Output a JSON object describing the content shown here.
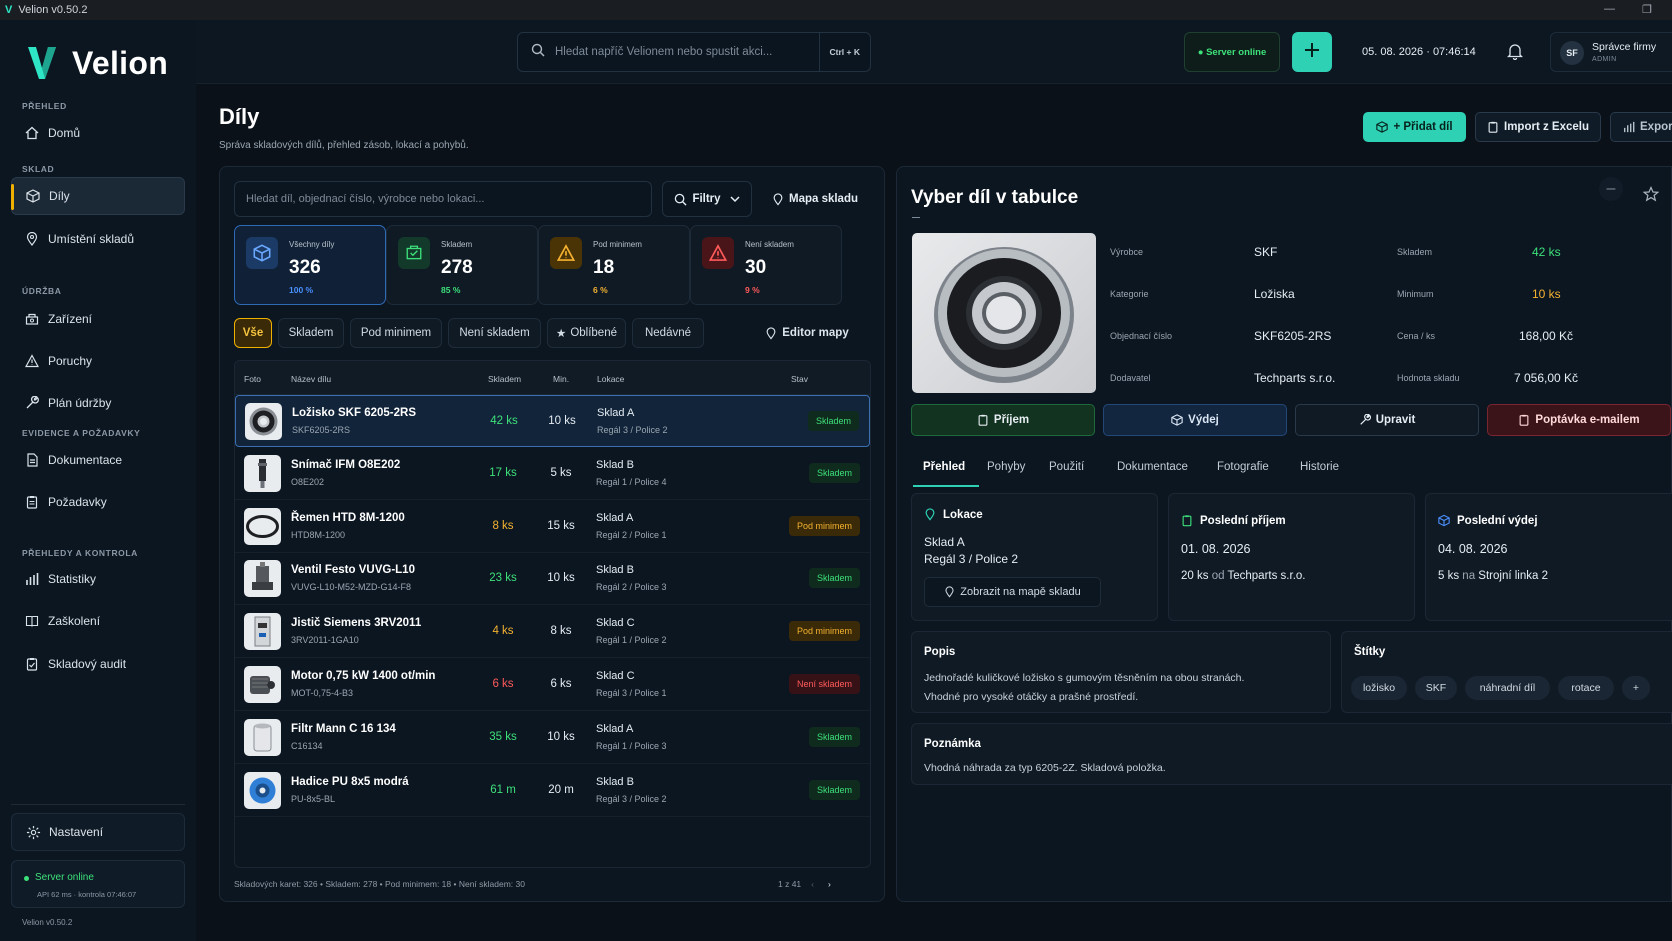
{
  "window": {
    "title": "Velion v0.50.2"
  },
  "brand": {
    "name": "Velion"
  },
  "sidebar": {
    "sections": [
      "PŘEHLED",
      "SKLAD",
      "ÚDRŽBA",
      "EVIDENCE A POŽADAVKY",
      "PŘEHLEDY A KONTROLA"
    ],
    "items": [
      "Domů",
      "Díly",
      "Umístění skladů",
      "Zařízení",
      "Poruchy",
      "Plán údržby",
      "Dokumentace",
      "Požadavky",
      "Statistiky",
      "Zaškolení",
      "Skladový audit"
    ],
    "settings": "Nastavení",
    "server_title": "Server online",
    "server_sub": "API 62 ms · kontrola 07:46:07",
    "version": "Velion v0.50.2"
  },
  "topbar": {
    "search_placeholder": "Hledat napříč Velionem nebo spustit akci...",
    "shortcut": "Ctrl + K",
    "server": "● Server online",
    "datetime": "05. 08. 2026 · 07:46:14",
    "user_initials": "SF",
    "user_name": "Správce firmy",
    "user_role": "ADMIN"
  },
  "page": {
    "title": "Díly",
    "subtitle": "Správa skladových dílů, přehled zásob, lokací a pohybů.",
    "btn_add": "+ Přidat díl",
    "btn_import": "Import z Excelu",
    "btn_export": "Export"
  },
  "list": {
    "search_placeholder": "Hledat díl, objednací číslo, výrobce nebo lokaci...",
    "filters": "Filtry",
    "map": "Mapa skladu",
    "stats": [
      {
        "label": "Všechny díly",
        "value": "326",
        "pct": "100 %"
      },
      {
        "label": "Skladem",
        "value": "278",
        "pct": "85 %"
      },
      {
        "label": "Pod minimem",
        "value": "18",
        "pct": "6 %"
      },
      {
        "label": "Není skladem",
        "value": "30",
        "pct": "9 %"
      }
    ],
    "chips": [
      "Vše",
      "Skladem",
      "Pod minimem",
      "Není skladem",
      "Oblíbené",
      "Nedávné"
    ],
    "map_editor": "Editor mapy",
    "columns": [
      "Foto",
      "Název dílu",
      "Skladem",
      "Min.",
      "Lokace",
      "Stav"
    ],
    "rows": [
      {
        "name": "Ložisko SKF 6205-2RS",
        "code": "SKF6205-2RS",
        "qty": "42 ks",
        "min": "10 ks",
        "loc": "Sklad A",
        "loc2": "Regál 3 / Police 2",
        "status": "Skladem"
      },
      {
        "name": "Snímač IFM O8E202",
        "code": "O8E202",
        "qty": "17 ks",
        "min": "5 ks",
        "loc": "Sklad B",
        "loc2": "Regál 1 / Police 4",
        "status": "Skladem"
      },
      {
        "name": "Řemen HTD 8M-1200",
        "code": "HTD8M-1200",
        "qty": "8 ks",
        "min": "15 ks",
        "loc": "Sklad A",
        "loc2": "Regál 2 / Police 1",
        "status": "Pod minimem"
      },
      {
        "name": "Ventil Festo VUVG-L10",
        "code": "VUVG-L10-M52-MZD-G14-F8",
        "qty": "23 ks",
        "min": "10 ks",
        "loc": "Sklad B",
        "loc2": "Regál 2 / Police 3",
        "status": "Skladem"
      },
      {
        "name": "Jistič Siemens 3RV2011",
        "code": "3RV2011-1GA10",
        "qty": "4 ks",
        "min": "8 ks",
        "loc": "Sklad C",
        "loc2": "Regál 1 / Police 2",
        "status": "Pod minimem"
      },
      {
        "name": "Motor 0,75 kW 1400 ot/min",
        "code": "MOT-0,75-4-B3",
        "qty": "6 ks",
        "min": "6 ks",
        "loc": "Sklad C",
        "loc2": "Regál 3 / Police 1",
        "status": "Není skladem"
      },
      {
        "name": "Filtr Mann C 16 134",
        "code": "C16134",
        "qty": "35 ks",
        "min": "10 ks",
        "loc": "Sklad A",
        "loc2": "Regál 1 / Police 3",
        "status": "Skladem"
      },
      {
        "name": "Hadice PU 8x5 modrá",
        "code": "PU-8x5-BL",
        "qty": "61 m",
        "min": "20 m",
        "loc": "Sklad B",
        "loc2": "Regál 3 / Police 2",
        "status": "Skladem"
      }
    ],
    "footer": "Skladových karet: 326 • Skladem: 278 • Pod minimem: 18 • Není skladem: 30",
    "page": "1 z 41"
  },
  "detail": {
    "title": "Vyber díl v tabulce",
    "fields": [
      {
        "label": "Výrobce",
        "value": "SKF"
      },
      {
        "label": "Kategorie",
        "value": "Ložiska"
      },
      {
        "label": "Objednací číslo",
        "value": "SKF6205-2RS"
      },
      {
        "label": "Dodavatel",
        "value": "Techparts s.r.o."
      }
    ],
    "fields2": [
      {
        "label": "Skladem",
        "value": "42 ks"
      },
      {
        "label": "Minimum",
        "value": "10 ks"
      },
      {
        "label": "Cena / ks",
        "value": "168,00 Kč"
      },
      {
        "label": "Hodnota skladu",
        "value": "7 056,00 Kč"
      }
    ],
    "actions": [
      "Příjem",
      "Výdej",
      "Upravit",
      "Poptávka e-mailem"
    ],
    "tabs": [
      "Přehled",
      "Pohyby",
      "Použití",
      "Dokumentace",
      "Fotografie",
      "Historie"
    ],
    "location": {
      "title": "Lokace",
      "line1": "Sklad A",
      "line2": "Regál 3 / Police 2",
      "btn": "Zobrazit na mapě skladu"
    },
    "last_in": {
      "title": "Poslední příjem",
      "date": "01. 08. 2026",
      "qty": "20 ks",
      "mid": "od",
      "who": "Techparts s.r.o."
    },
    "last_out": {
      "title": "Poslední výdej",
      "date": "04. 08. 2026",
      "qty": "5 ks",
      "mid": "na",
      "who": "Strojní linka 2"
    },
    "desc": {
      "title": "Popis",
      "line1": "Jednořadé kuličkové ložisko s gumovým těsněním na obou stranách.",
      "line2": "Vhodné pro vysoké otáčky a prašné prostředí."
    },
    "tags": {
      "title": "Štítky",
      "items": [
        "ložisko",
        "SKF",
        "náhradní díl",
        "rotace",
        "+"
      ]
    },
    "note": {
      "title": "Poznámka",
      "text": "Vhodná náhrada za typ 6205-2Z. Skladová položka."
    }
  },
  "colors": {
    "accent": "#2ed1b3",
    "ok": "#3de07a",
    "warn": "#f5b230",
    "danger": "#ff5a5a",
    "highlight": "#f0b000",
    "select": "#3b6fb0"
  }
}
